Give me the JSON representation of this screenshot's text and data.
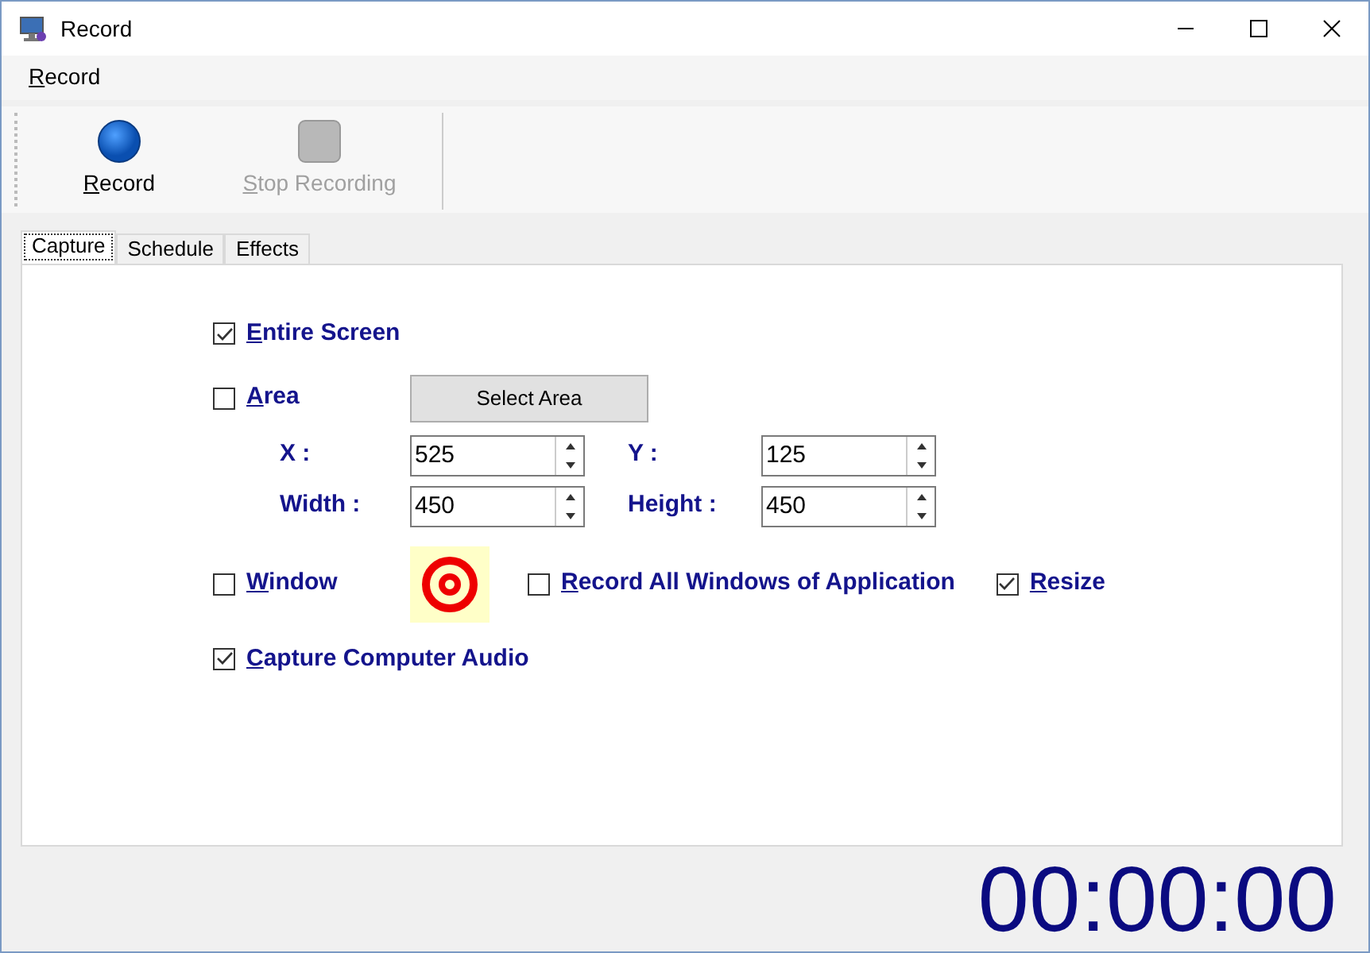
{
  "window": {
    "title": "Record"
  },
  "menu": [
    "Record"
  ],
  "toolbar": [
    {
      "label": "Record",
      "kind": "record",
      "disabled": false
    },
    {
      "label": "Stop Recording",
      "kind": "stop",
      "disabled": true
    }
  ],
  "tabs": [
    {
      "label": "Capture",
      "selected": true
    },
    {
      "label": "Schedule",
      "selected": false
    },
    {
      "label": "Effects",
      "selected": false
    }
  ],
  "capture": {
    "entire_screen": {
      "label": "Entire Screen",
      "checked": true
    },
    "area": {
      "label": "Area",
      "checked": false
    },
    "select_area_button": "Select Area",
    "fields": [
      {
        "label": "X :",
        "value": "525"
      },
      {
        "label": "Y :",
        "value": "125"
      },
      {
        "label": "Width :",
        "value": "450"
      },
      {
        "label": "Height :",
        "value": "450"
      }
    ],
    "window": {
      "label": "Window",
      "checked": false
    },
    "record_all_windows": {
      "label": "Record All Windows of Application",
      "checked": false
    },
    "resize": {
      "label": "Resize",
      "checked": true
    },
    "capture_audio": {
      "label": "Capture Computer Audio",
      "checked": true
    }
  },
  "timer": "00:00:00"
}
